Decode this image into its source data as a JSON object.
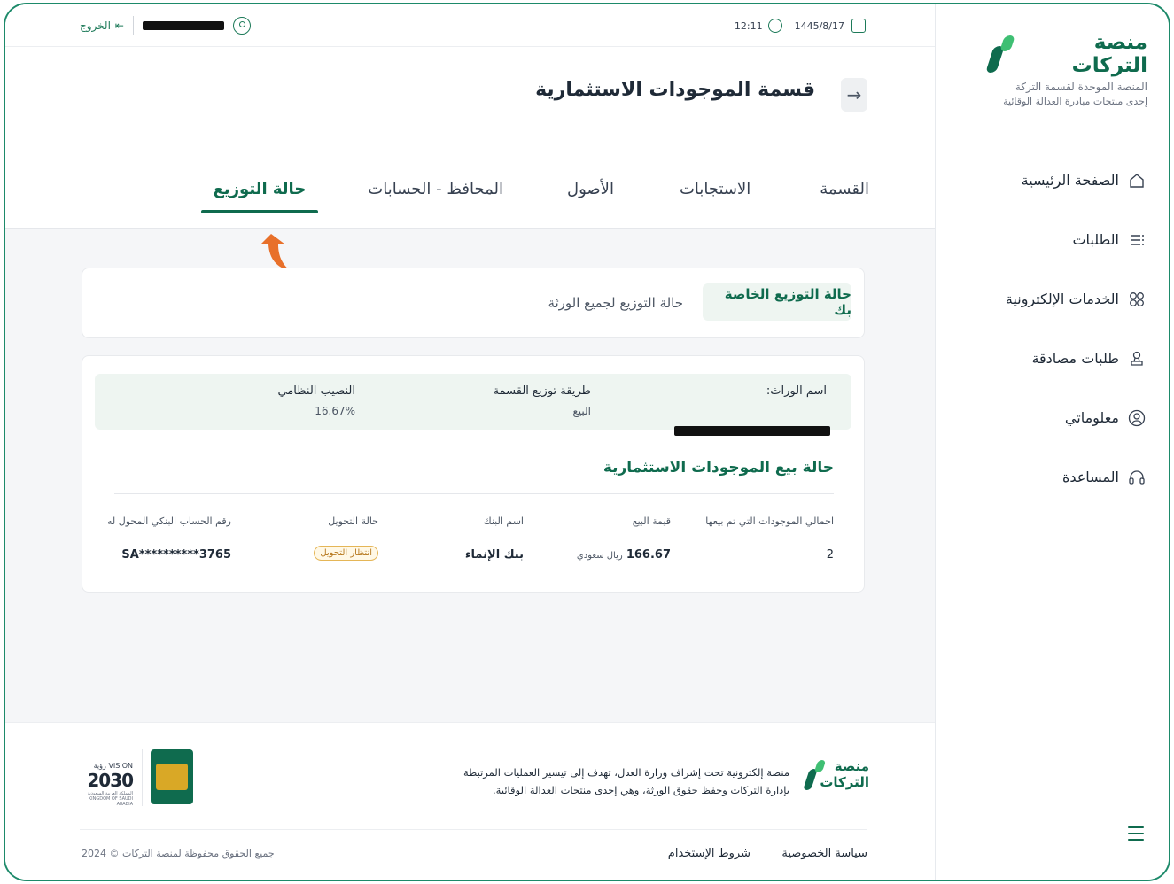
{
  "brand": {
    "name": "منصة التركات",
    "subtitle": "المنصة الموحدة لقسمة التركة",
    "tagline": "إحدى منتجات مبادرة العدالة الوقائية"
  },
  "sidebar": {
    "items": [
      {
        "label": "الصفحة الرئيسية",
        "icon": "home-icon"
      },
      {
        "label": "الطلبات",
        "icon": "list-icon"
      },
      {
        "label": "الخدمات الإلكترونية",
        "icon": "grid-icon"
      },
      {
        "label": "طلبات مصادقة",
        "icon": "stamp-icon"
      },
      {
        "label": "معلوماتي",
        "icon": "user-circle-icon"
      },
      {
        "label": "المساعدة",
        "icon": "headset-icon"
      }
    ]
  },
  "topbar": {
    "date": "1445/8/17",
    "time": "12:11",
    "logout": "الخروج"
  },
  "page": {
    "title": "قسمة الموجودات الاستثمارية",
    "tabs": [
      "القسمة",
      "الاستجابات",
      "الأصول",
      "المحافظ - الحسابات",
      "حالة التوزيع"
    ],
    "active_tab": "حالة التوزيع"
  },
  "subtabs": {
    "active": "حالة التوزيع الخاصة بك",
    "other": "حالة التوزيع لجميع الورثة"
  },
  "info": {
    "heir_label": "اسم الوراث:",
    "method_label": "طريقة توزيع القسمة",
    "method_value": "البيع",
    "share_label": "النصيب النظامي",
    "share_value": "16.67%"
  },
  "sale": {
    "title": "حالة بيع الموجودات الاستثمارية",
    "headers": [
      "اجمالي الموجودات التي تم بيعها",
      "قيمة البيع",
      "اسم البنك",
      "حالة التحويل",
      "رقم الحساب البنكي المحول له"
    ],
    "row": {
      "total": "2",
      "amount": "166.67",
      "currency": "ريال سعودي",
      "bank": "بنك الإنماء",
      "status": "انتظار التحويل",
      "account": "SA**********3765"
    }
  },
  "footer": {
    "logo_line1": "منصة",
    "logo_line2": "التركات",
    "description": "منصة إلكترونية تحت إشراف وزارة العدل، تهدف إلى تيسير العمليات المرتبطة بإدارة التركات وحفظ حقوق الورثة، وهي إحدى منتجات العدالة الوقائية.",
    "vision_small": "VISION رؤية",
    "vision_year": "2030",
    "vision_caption": "المملكة العربية السعودية KINGDOM OF SAUDI ARABIA",
    "privacy": "سياسة الخصوصية",
    "terms": "شروط الإستخدام",
    "copyright": "جميع الحقوق محفوظة لمنصة التركات © 2024"
  }
}
